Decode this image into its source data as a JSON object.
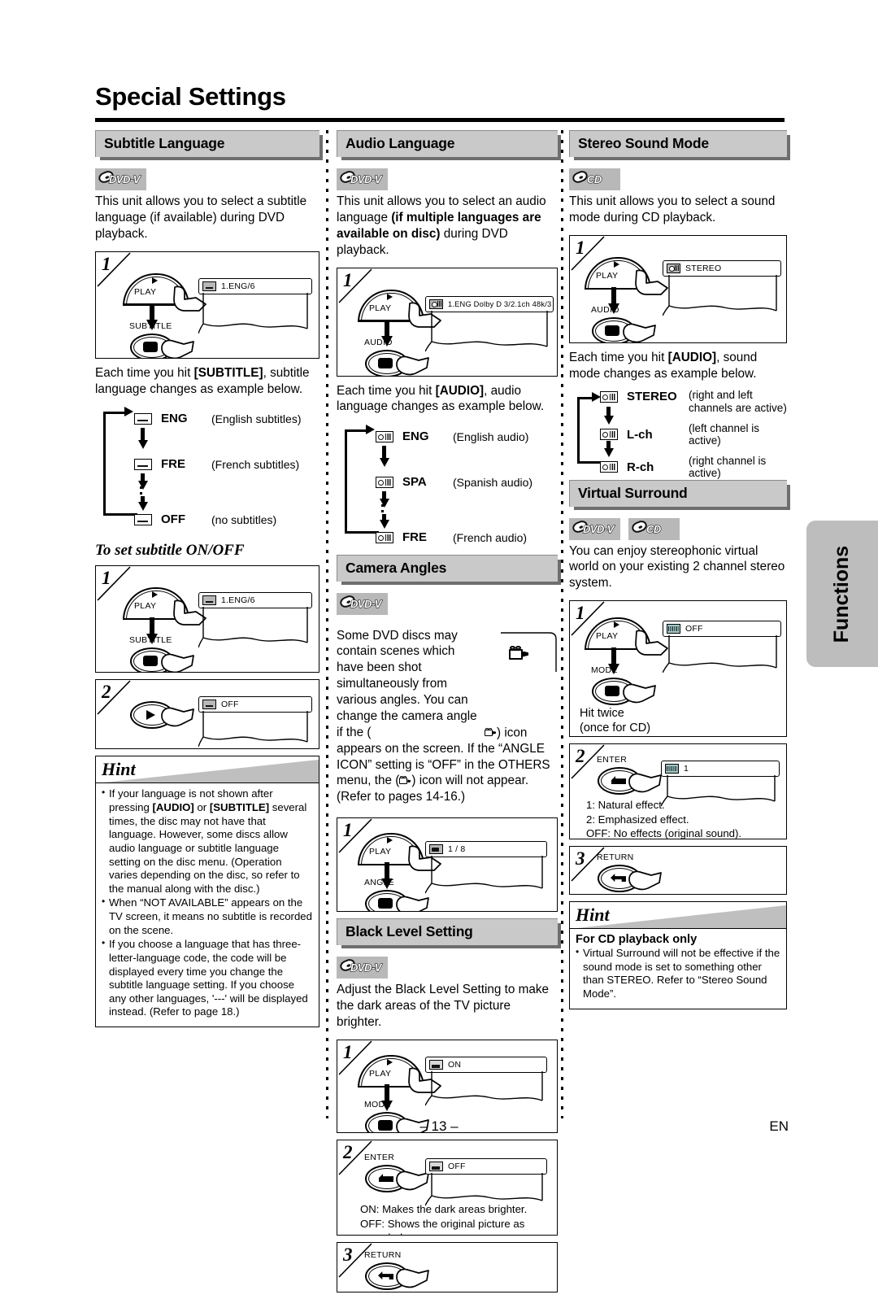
{
  "page": {
    "title": "Special Settings",
    "page_number": "– 13 –",
    "language_mark": "EN",
    "side_tab": "Functions"
  },
  "col1": {
    "heading": "Subtitle Language",
    "badges": [
      "DVD-V"
    ],
    "intro": "This unit allows you to select a subtitle language (if available) during DVD playback.",
    "step1": {
      "num": "1",
      "play_label": "PLAY",
      "button_label": "SUBTITLE",
      "osd_text": "1.ENG/6"
    },
    "each_time": "Each time you hit [SUBTITLE], subtitle language changes as example below.",
    "each_time_bold": "[SUBTITLE]",
    "chain": [
      {
        "code": "ENG",
        "desc": "(English subtitles)"
      },
      {
        "code": "FRE",
        "desc": "(French subtitles)"
      },
      {
        "code": "OFF",
        "desc": "(no subtitles)"
      }
    ],
    "onoff_heading": "To set subtitle ON/OFF",
    "onoff_step1": {
      "num": "1",
      "play_label": "PLAY",
      "button_label": "SUBTITLE",
      "osd_text": "1.ENG/6"
    },
    "onoff_step2": {
      "num": "2",
      "osd_text": "OFF"
    },
    "hint": {
      "title": "Hint",
      "items": [
        "If your language is not shown after pressing [AUDIO] or [SUBTITLE] several times, the disc may not have that language. However, some discs allow audio language or subtitle language setting on the disc menu. (Operation varies depending on the disc, so refer to the manual along with the disc.)",
        "When “NOT AVAILABLE” appears on the TV screen, it means no subtitle is recorded on the scene.",
        "If you choose a language that has three-letter-language code, the code will be displayed every time you change the subtitle language setting. If you choose any other languages, '---' will be displayed instead. (Refer to page 18.)"
      ]
    }
  },
  "col2": {
    "heading": "Audio Language",
    "badges": [
      "DVD-V"
    ],
    "intro_a": "This unit allows you to select an audio language ",
    "intro_b": "(if multiple languages are available on disc)",
    "intro_c": " during DVD playback.",
    "step1": {
      "num": "1",
      "play_label": "PLAY",
      "button_label": "AUDIO",
      "osd_text": "1.ENG  Dolby D  3/2.1ch  48k/3"
    },
    "each_time": "Each time you hit [AUDIO], audio language changes as example below.",
    "chain": [
      {
        "code": "ENG",
        "desc": "(English audio)"
      },
      {
        "code": "SPA",
        "desc": "(Spanish audio)"
      },
      {
        "code": "FRE",
        "desc": "(French audio)"
      }
    ],
    "camera": {
      "heading": "Camera Angles",
      "badges": [
        "DVD-V"
      ],
      "text_1": "Some DVD discs may contain scenes which have been shot simultaneously from various angles. You can change the camera angle if the (",
      "text_2": ") icon appears on the screen. If the “ANGLE ICON” setting is “OFF” in the OTHERS menu, the (",
      "text_3": ") icon will not appear. (Refer to pages 14-16.)",
      "step1": {
        "num": "1",
        "play_label": "PLAY",
        "button_label": "ANGLE",
        "osd_text": "1 / 8"
      }
    },
    "black": {
      "heading": "Black Level Setting",
      "badges": [
        "DVD-V"
      ],
      "intro": "Adjust the Black Level Setting to make the dark areas of the TV picture brighter.",
      "step1": {
        "num": "1",
        "play_label": "PLAY",
        "button_label": "MODE",
        "osd_text": "ON"
      },
      "step2": {
        "num": "2",
        "button_label": "ENTER",
        "osd_text": "OFF",
        "note_1": "ON: Makes the dark areas brighter.",
        "note_2": "OFF: Shows the original picture as recorded."
      },
      "step3": {
        "num": "3",
        "button_label": "RETURN"
      }
    }
  },
  "col3": {
    "heading": "Stereo Sound Mode",
    "badges": [
      "CD"
    ],
    "intro": "This unit allows you to select a sound mode during CD playback.",
    "step1": {
      "num": "1",
      "play_label": "PLAY",
      "button_label": "AUDIO",
      "osd_text": "STEREO"
    },
    "each_time": "Each time you hit [AUDIO], sound mode changes as example below.",
    "chain": [
      {
        "code": "STEREO",
        "desc": "(right and left channels are active)"
      },
      {
        "code": "L-ch",
        "desc": "(left channel is active)"
      },
      {
        "code": "R-ch",
        "desc": "(right channel is active)"
      }
    ],
    "virtual": {
      "heading": "Virtual Surround",
      "badges": [
        "DVD-V",
        "CD"
      ],
      "intro": "You can enjoy stereophonic virtual world on your existing 2 channel stereo system.",
      "step1": {
        "num": "1",
        "play_label": "PLAY",
        "button_label": "MODE",
        "osd_text": "OFF",
        "note_1": "Hit twice",
        "note_2": "(once for CD)"
      },
      "step2": {
        "num": "2",
        "button_label": "ENTER",
        "osd_text": "1",
        "note_1": "1: Natural effect.",
        "note_2": "2: Emphasized effect.",
        "note_3": "OFF: No effects (original sound)."
      },
      "step3": {
        "num": "3",
        "button_label": "RETURN"
      },
      "hint": {
        "title": "Hint",
        "subtitle": "For CD playback only",
        "items": [
          "Virtual Surround will not be effective if the sound mode is set to something other than STEREO. Refer to “Stereo Sound Mode”."
        ]
      }
    }
  },
  "colors": {
    "heading_bg": "#c9c9c9",
    "heading_shadow": "#6e6e6e",
    "badge_bg": "#b8b8b8",
    "tab_bg": "#bdbdbd"
  }
}
